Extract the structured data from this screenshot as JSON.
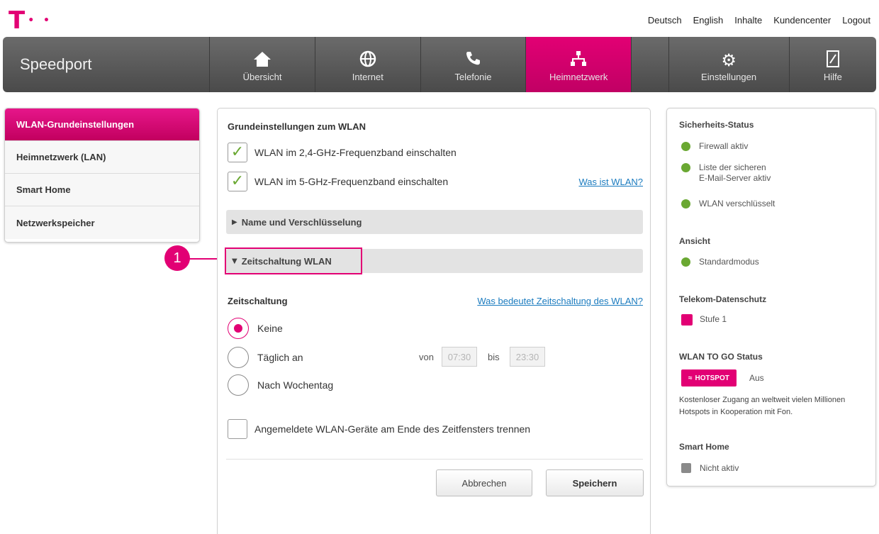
{
  "logo": {
    "mark": "T",
    "dots": "• •"
  },
  "top_links": [
    "Deutsch",
    "English",
    "Inhalte",
    "Kundencenter",
    "Logout"
  ],
  "nav": {
    "brand": "Speedport",
    "items": [
      {
        "label": "Übersicht",
        "icon": "home-icon"
      },
      {
        "label": "Internet",
        "icon": "globe-icon"
      },
      {
        "label": "Telefonie",
        "icon": "phone-icon"
      },
      {
        "label": "Heimnetzwerk",
        "icon": "network-icon"
      },
      {
        "label": "Einstellungen",
        "icon": "gear-icon"
      },
      {
        "label": "Hilfe",
        "icon": "help-icon"
      }
    ],
    "active": "Heimnetzwerk"
  },
  "sidebar": {
    "items": [
      {
        "label": "WLAN-Grundeinstellungen"
      },
      {
        "label": "Heimnetzwerk (LAN)"
      },
      {
        "label": "Smart Home"
      },
      {
        "label": "Netzwerkspeicher"
      }
    ]
  },
  "main": {
    "title": "Grundeinstellungen zum WLAN",
    "cb_24": "WLAN im 2,4-GHz-Frequenzband einschalten",
    "cb_5": "WLAN im 5-GHz-Frequenzband einschalten",
    "help_wlan": "Was ist WLAN?",
    "acc_name": "Name und Verschlüsselung",
    "acc_zeit": "Zeitschaltung WLAN",
    "zeit_title": "Zeitschaltung",
    "help_zeit": "Was bedeutet Zeitschaltung des WLAN?",
    "radio_keine": "Keine",
    "radio_taeglich": "Täglich an",
    "radio_woche": "Nach Wochentag",
    "von": "von",
    "von_value": "07:30",
    "bis": "bis",
    "bis_value": "23:30",
    "cb_trennen": "Angemeldete WLAN-Geräte am Ende des Zeitfensters trennen",
    "btn_cancel": "Abbrechen",
    "btn_save": "Speichern"
  },
  "callout": "1",
  "status": {
    "security_title": "Sicherheits-Status",
    "firewall": "Firewall aktiv",
    "mail_1": "Liste der sicheren",
    "mail_2": "E-Mail-Server aktiv",
    "wlan_enc": "WLAN verschlüsselt",
    "view_title": "Ansicht",
    "view_mode": "Standardmodus",
    "privacy_title": "Telekom-Datenschutz",
    "privacy_level": "Stufe 1",
    "wlan_to_go_title": "WLAN TO GO Status",
    "hotspot_label": "HOTSPOT",
    "hotspot_state": "Aus",
    "hotspot_text": "Kostenloser Zugang an weltweit vielen Millionen Hotspots in Kooperation mit Fon.",
    "smart_home_title": "Smart Home",
    "smart_home_state": "Nicht aktiv"
  },
  "colors": {
    "brand": "#e20074",
    "ok": "#6aa832",
    "link": "#1a7bbf"
  }
}
